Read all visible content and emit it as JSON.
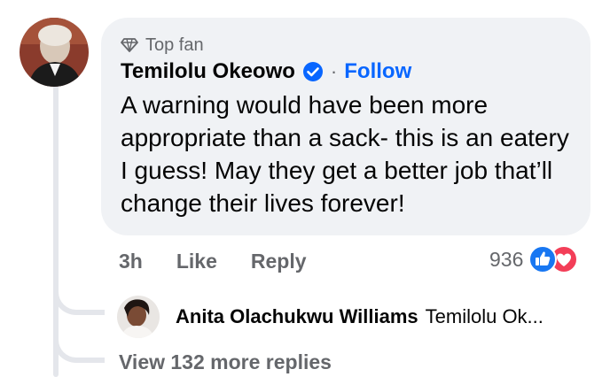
{
  "comment": {
    "badge": "Top fan",
    "author": "Temilolu Okeowo",
    "separator": "·",
    "follow_label": "Follow",
    "text": "A warning would have been more appropriate than a sack- this is an eatery I guess! May they get a better job that’ll change their lives forever!",
    "time": "3h",
    "like_label": "Like",
    "reply_label": "Reply",
    "reaction_count": "936",
    "reaction_icons": [
      "like-reaction-icon",
      "love-reaction-icon"
    ]
  },
  "reply_preview": {
    "author": "Anita Olachukwu Williams",
    "snippet": "Temilolu Ok..."
  },
  "view_more_label": "View 132 more replies",
  "colors": {
    "bubble": "#f0f2f5",
    "link": "#0866ff",
    "secondary_text": "#65676b",
    "love": "#f33e58",
    "thread_line": "#e4e6eb"
  }
}
